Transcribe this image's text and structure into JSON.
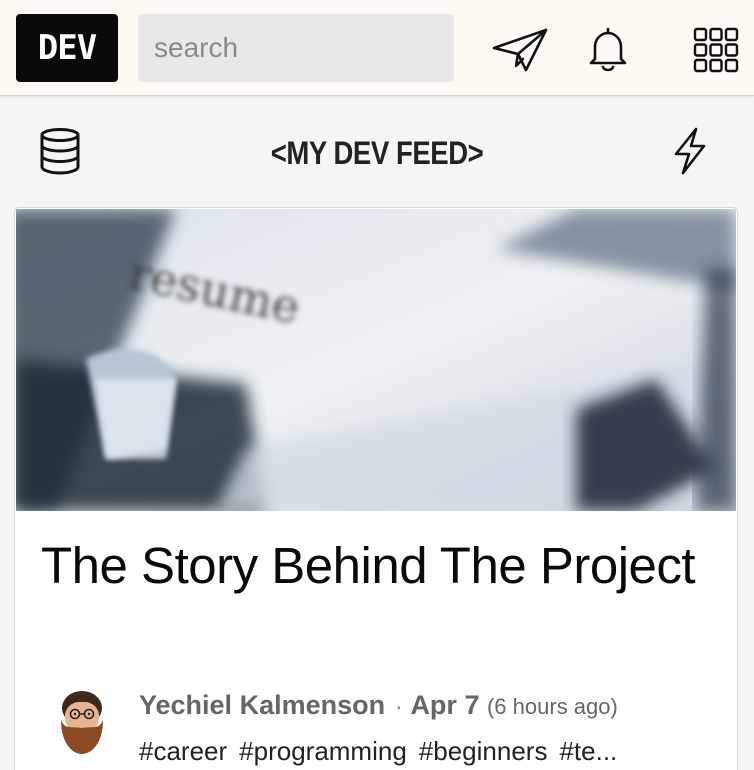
{
  "app": {
    "logo": "DEV"
  },
  "search": {
    "placeholder": "search"
  },
  "topbar": {
    "icons": [
      "paper-plane-icon",
      "bell-icon",
      "apps-grid-icon"
    ]
  },
  "feed_header": {
    "title": "<MY DEV FEED>",
    "left_icon": "database-icon",
    "right_icon": "lightning-icon"
  },
  "article": {
    "cover_text": "resume",
    "title": "The Story Behind The Project",
    "author": "Yechiel Kalmenson",
    "separator": "·",
    "date": "Apr 7",
    "relative_time": "(6 hours ago)",
    "tags": [
      "#career",
      "#programming",
      "#beginners",
      "#te..."
    ]
  },
  "colors": {
    "topbar_bg": "#fdf9f3",
    "page_bg": "#f5f5f5",
    "logo_bg": "#0a0a0a",
    "meta_text": "#666666"
  }
}
